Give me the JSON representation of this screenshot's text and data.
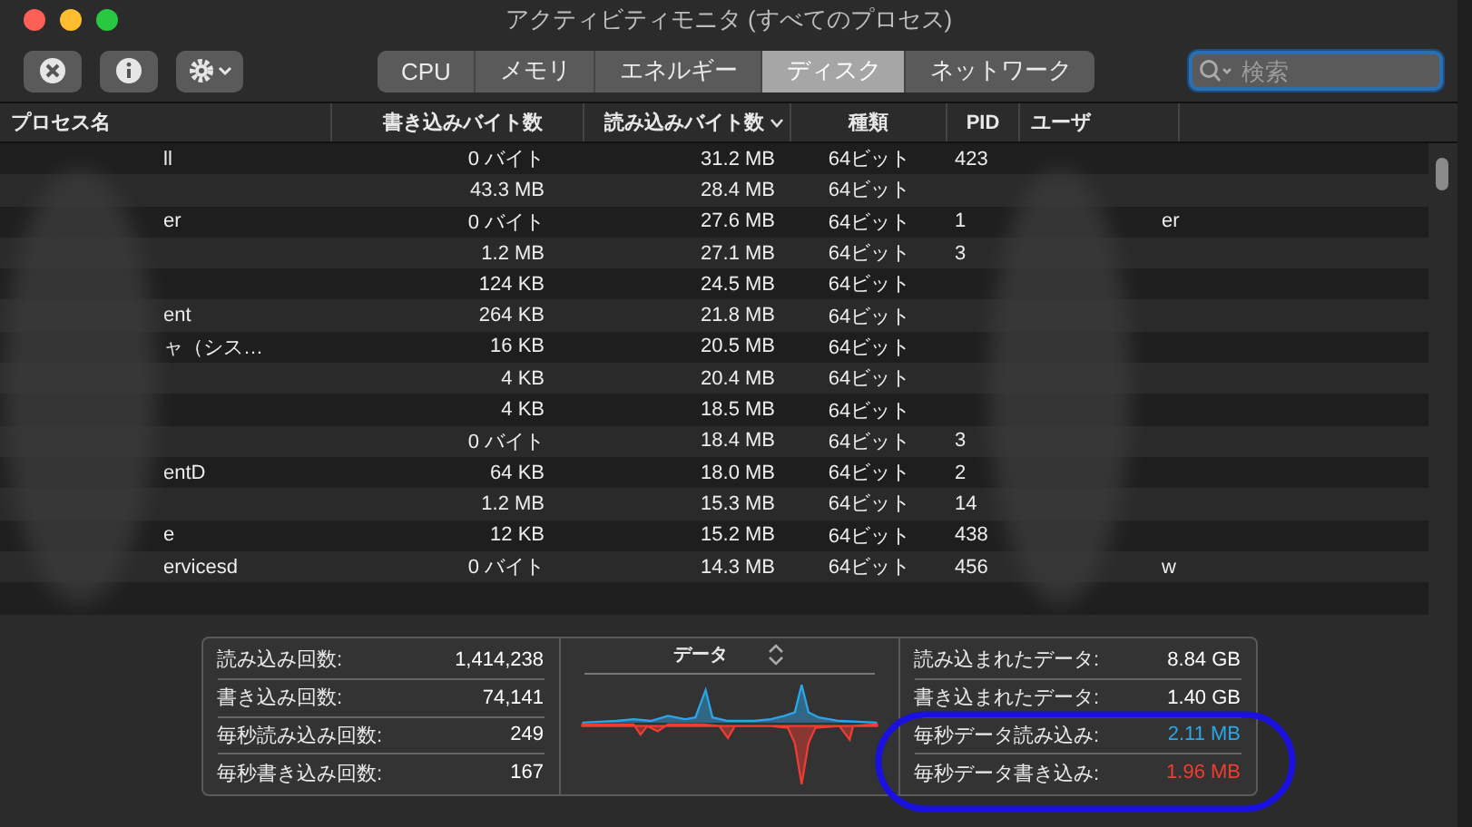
{
  "window": {
    "title": "アクティビティモニタ (すべてのプロセス)"
  },
  "toolbar": {
    "tabs": [
      {
        "label": "CPU",
        "selected": false
      },
      {
        "label": "メモリ",
        "selected": false
      },
      {
        "label": "エネルギー",
        "selected": false
      },
      {
        "label": "ディスク",
        "selected": true
      },
      {
        "label": "ネットワーク",
        "selected": false
      }
    ],
    "search": {
      "placeholder": "検索"
    }
  },
  "table": {
    "columns": [
      {
        "label": "プロセス名",
        "sorted": false
      },
      {
        "label": "書き込みバイト数",
        "sorted": false
      },
      {
        "label": "読み込みバイト数",
        "sorted": true
      },
      {
        "label": "種類",
        "sorted": false
      },
      {
        "label": "PID",
        "sorted": false
      },
      {
        "label": "ユーザ",
        "sorted": false
      }
    ],
    "rows": [
      {
        "cells": [
          "ll",
          "0 バイト",
          "31.2 MB",
          "64ビット",
          "423",
          ""
        ]
      },
      {
        "cells": [
          "",
          "43.3 MB",
          "28.4 MB",
          "64ビット",
          "",
          ""
        ]
      },
      {
        "cells": [
          "er",
          "0 バイト",
          "27.6 MB",
          "64ビット",
          "1",
          "er"
        ]
      },
      {
        "cells": [
          "",
          "1.2 MB",
          "27.1 MB",
          "64ビット",
          "3",
          ""
        ]
      },
      {
        "cells": [
          "",
          "124 KB",
          "24.5 MB",
          "64ビット",
          "",
          ""
        ]
      },
      {
        "cells": [
          "ent",
          "264 KB",
          "21.8 MB",
          "64ビット",
          "",
          ""
        ]
      },
      {
        "cells": [
          "ャ（シス…",
          "16 KB",
          "20.5 MB",
          "64ビット",
          "",
          ""
        ]
      },
      {
        "cells": [
          "",
          "4 KB",
          "20.4 MB",
          "64ビット",
          "",
          ""
        ]
      },
      {
        "cells": [
          "",
          "4 KB",
          "18.5 MB",
          "64ビット",
          "",
          ""
        ]
      },
      {
        "cells": [
          "",
          "0 バイト",
          "18.4 MB",
          "64ビット",
          "3",
          ""
        ]
      },
      {
        "cells": [
          "entD",
          "64 KB",
          "18.0 MB",
          "64ビット",
          "2",
          ""
        ]
      },
      {
        "cells": [
          "",
          "1.2 MB",
          "15.3 MB",
          "64ビット",
          "14",
          ""
        ]
      },
      {
        "cells": [
          "e",
          "12 KB",
          "15.2 MB",
          "64ビット",
          "438",
          ""
        ]
      },
      {
        "cells": [
          "ervicesd",
          "0 バイト",
          "14.3 MB",
          "64ビット",
          "456",
          "w"
        ]
      }
    ]
  },
  "summary": {
    "left": [
      {
        "label": "読み込み回数:",
        "value": "1,414,238"
      },
      {
        "label": "書き込み回数:",
        "value": "74,141"
      },
      {
        "label": "毎秒読み込み回数:",
        "value": "249"
      },
      {
        "label": "毎秒書き込み回数:",
        "value": "167"
      }
    ],
    "graph": {
      "title": "データ"
    },
    "right": [
      {
        "label": "読み込まれたデータ:",
        "value": "8.84 GB",
        "color": "#ffffff"
      },
      {
        "label": "書き込まれたデータ:",
        "value": "1.40 GB",
        "color": "#ffffff"
      },
      {
        "label": "毎秒データ読み込み:",
        "value": "2.11 MB",
        "color": "#2aa7e8"
      },
      {
        "label": "毎秒データ書き込み:",
        "value": "1.96 MB",
        "color": "#f03c32"
      }
    ]
  }
}
